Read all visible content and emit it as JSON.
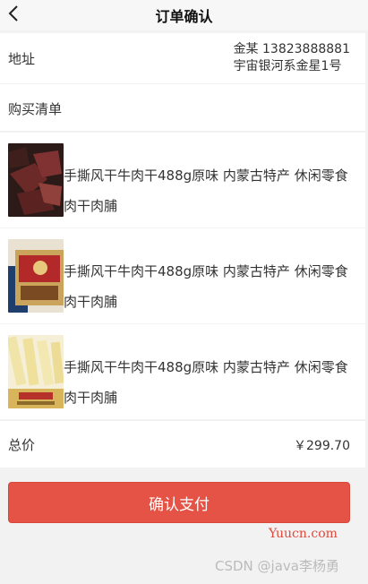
{
  "header": {
    "title": "订单确认"
  },
  "address": {
    "label": "地址",
    "name_phone": "金某 13823888881",
    "detail": "宇宙银河系金星1号"
  },
  "list": {
    "label": "购买清单",
    "items": [
      {
        "name": "手撕风干牛肉干488g原味 内蒙古特产 休闲零食 肉干肉脯",
        "image": "dark beef jerky pieces"
      },
      {
        "name": "手撕风干牛肉干488g原味 内蒙古特产 休闲零食 肉干肉脯",
        "image": "gift box packaging"
      },
      {
        "name": "手撕风干牛肉干488g原味 内蒙古特产 休闲零食 肉干肉脯",
        "image": "light yellow snack sticks"
      }
    ]
  },
  "total": {
    "label": "总价",
    "price": "￥299.70"
  },
  "actions": {
    "pay_label": "确认支付"
  },
  "watermarks": {
    "yuucn": "Yuucn.com",
    "csdn": "CSDN @java李杨勇"
  },
  "colors": {
    "accent": "#e45345",
    "background": "#f2f2f2"
  }
}
